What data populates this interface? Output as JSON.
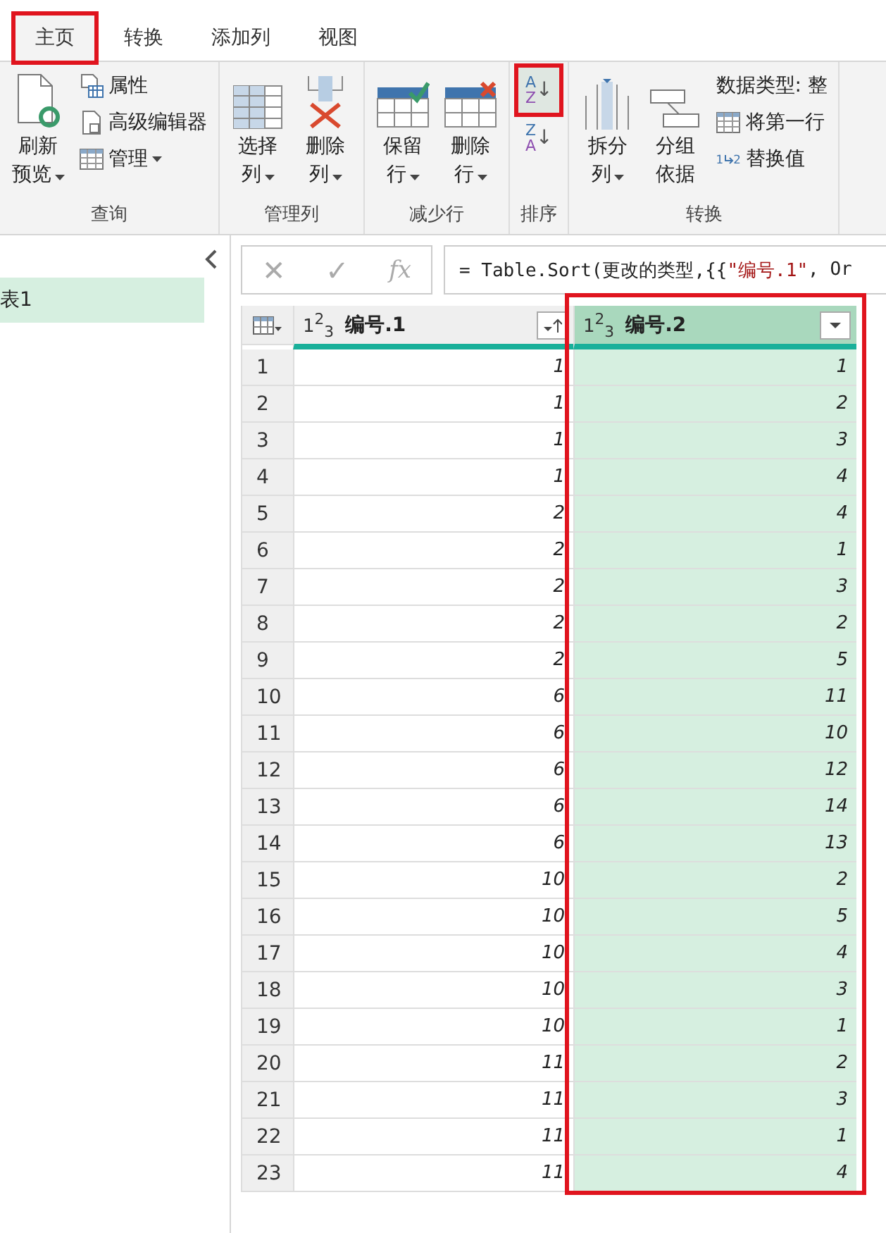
{
  "tabs": [
    {
      "label": "主页",
      "selected": true,
      "highlighted": true
    },
    {
      "label": "转换",
      "selected": false,
      "highlighted": false
    },
    {
      "label": "添加列",
      "selected": false,
      "highlighted": false
    },
    {
      "label": "视图",
      "selected": false,
      "highlighted": false
    }
  ],
  "ribbon": {
    "groups": [
      {
        "label": "查询",
        "items": [
          {
            "kind": "large",
            "lines": [
              "刷新",
              "预览"
            ],
            "dropdown": true
          },
          {
            "kind": "stack",
            "items": [
              {
                "label": "属性",
                "dropdown": false
              },
              {
                "label": "高级编辑器",
                "dropdown": false
              },
              {
                "label": "管理",
                "dropdown": true
              }
            ]
          }
        ]
      },
      {
        "label": "管理列",
        "items": [
          {
            "kind": "large",
            "lines": [
              "选择",
              "列"
            ],
            "dropdown": true
          },
          {
            "kind": "large",
            "lines": [
              "删除",
              "列"
            ],
            "dropdown": true
          }
        ]
      },
      {
        "label": "减少行",
        "items": [
          {
            "kind": "large",
            "lines": [
              "保留",
              "行"
            ],
            "dropdown": true
          },
          {
            "kind": "large",
            "lines": [
              "删除",
              "行"
            ],
            "dropdown": true
          }
        ]
      },
      {
        "label": "排序",
        "items": [
          {
            "kind": "sort",
            "buttons": [
              {
                "top": "A",
                "bottom": "Z",
                "arrow": "↓",
                "highlighted": true
              },
              {
                "top": "Z",
                "bottom": "A",
                "arrow": "↓",
                "highlighted": false
              }
            ]
          }
        ]
      },
      {
        "label": "转换",
        "items": [
          {
            "kind": "large",
            "lines": [
              "拆分",
              "列"
            ],
            "dropdown": true
          },
          {
            "kind": "large",
            "lines": [
              "分组",
              "依据"
            ],
            "dropdown": false
          },
          {
            "kind": "stack",
            "items": [
              {
                "label": "数据类型: 整",
                "dropdown": false
              },
              {
                "label": "将第一行",
                "dropdown": false
              },
              {
                "digits": [
                  "1",
                  "2"
                ],
                "label": "替换值",
                "dropdown": false
              }
            ]
          }
        ]
      }
    ]
  },
  "queries": {
    "items": [
      {
        "label": "表1",
        "selected": true
      }
    ]
  },
  "formula_bar": {
    "buttons": [
      "✕",
      "✓",
      "fx"
    ],
    "formula": [
      {
        "kind": "code",
        "text": "= Table.Sort(更改的类型,{{"
      },
      {
        "kind": "string",
        "text": "\"编号.1\""
      },
      {
        "kind": "code",
        "text": ", Or"
      }
    ]
  },
  "table": {
    "columns": [
      {
        "type_label": "1$^{2}$$_{3}$",
        "name": "编号.1",
        "sorted": true,
        "highlighted": false
      },
      {
        "type_label": "1$^{2}$$_{3}$",
        "name": "编号.2",
        "sorted": false,
        "highlighted": true
      }
    ],
    "rows": [
      [
        "1",
        "1",
        "1"
      ],
      [
        "2",
        "1",
        "2"
      ],
      [
        "3",
        "1",
        "3"
      ],
      [
        "4",
        "1",
        "4"
      ],
      [
        "5",
        "2",
        "4"
      ],
      [
        "6",
        "2",
        "1"
      ],
      [
        "7",
        "2",
        "3"
      ],
      [
        "8",
        "2",
        "2"
      ],
      [
        "9",
        "2",
        "5"
      ],
      [
        "10",
        "6",
        "11"
      ],
      [
        "11",
        "6",
        "10"
      ],
      [
        "12",
        "6",
        "12"
      ],
      [
        "13",
        "6",
        "14"
      ],
      [
        "14",
        "6",
        "13"
      ],
      [
        "15",
        "10",
        "2"
      ],
      [
        "16",
        "10",
        "5"
      ],
      [
        "17",
        "10",
        "4"
      ],
      [
        "18",
        "10",
        "3"
      ],
      [
        "19",
        "10",
        "1"
      ],
      [
        "20",
        "11",
        "2"
      ],
      [
        "21",
        "11",
        "3"
      ],
      [
        "22",
        "11",
        "1"
      ],
      [
        "23",
        "11",
        "4"
      ]
    ]
  }
}
